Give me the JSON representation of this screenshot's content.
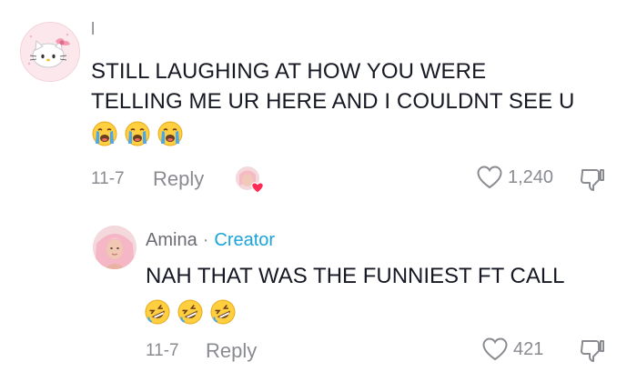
{
  "comment": {
    "username": "l",
    "text_line1": "STILL LAUGHING AT HOW YOU WERE",
    "text_line2": "TELLING ME UR HERE AND I COULDNT SEE U",
    "emojis": [
      "loudly-crying-face",
      "loudly-crying-face",
      "loudly-crying-face"
    ],
    "date": "11-7",
    "reply_label": "Reply",
    "like_count": "1,240",
    "avatar_icon": "hello-kitty-avatar",
    "creator_liked_icon": "creator-liked-heart-avatar"
  },
  "reply": {
    "author": "Amina",
    "separator": "·",
    "badge": "Creator",
    "text": "NAH THAT WAS THE FUNNIEST FT CALL",
    "emojis": [
      "rolling-on-the-floor-laughing",
      "rolling-on-the-floor-laughing",
      "rolling-on-the-floor-laughing"
    ],
    "date": "11-7",
    "reply_label": "Reply",
    "like_count": "421"
  },
  "colors": {
    "secondary_text": "#8a8b91",
    "creator_badge": "#1aa4d8",
    "heart_badge": "#fe2c55"
  }
}
